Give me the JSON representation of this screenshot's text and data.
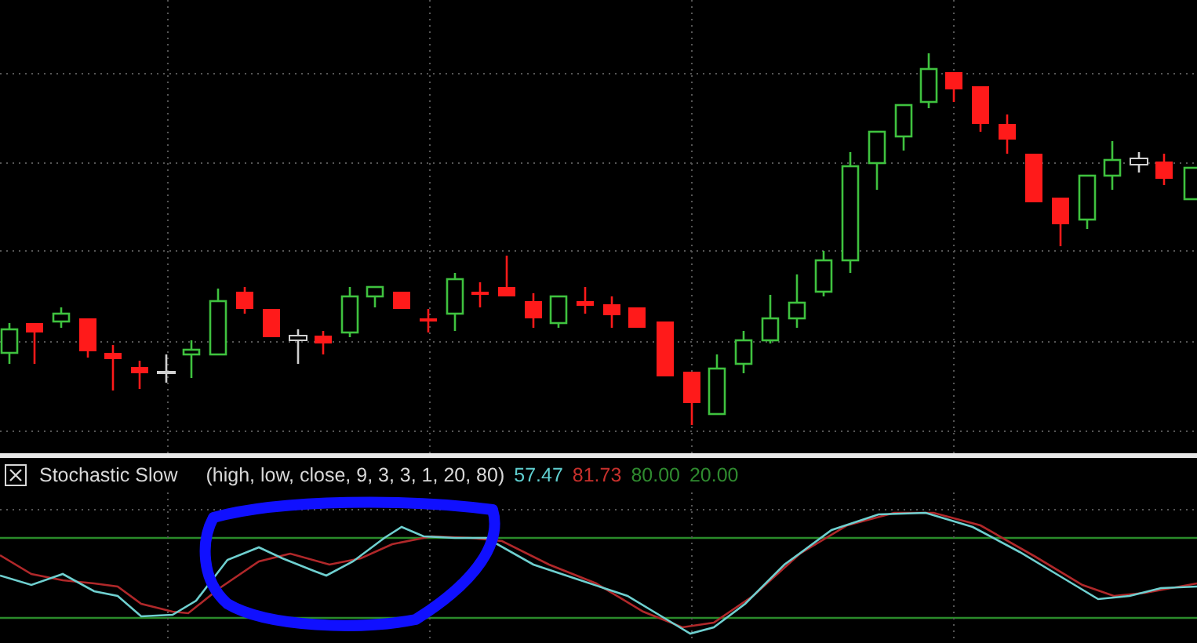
{
  "indicator": {
    "name": "Stochastic Slow",
    "params": "(high, low, close, 9, 3, 3, 1, 20, 80)",
    "readings": [
      {
        "text": "57.47",
        "color": "#5fcfd0"
      },
      {
        "text": "81.73",
        "color": "#c8302c"
      },
      {
        "text": "80.00",
        "color": "#2f8a2f"
      },
      {
        "text": "20.00",
        "color": "#2f8a2f"
      }
    ]
  }
}
